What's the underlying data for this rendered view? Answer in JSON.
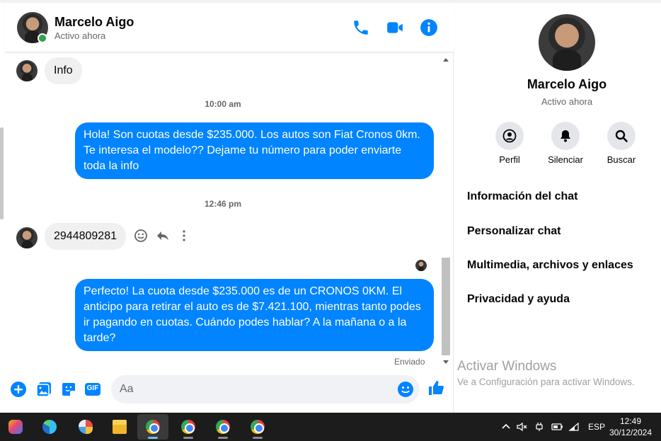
{
  "header": {
    "name": "Marcelo Aigo",
    "status": "Activo ahora"
  },
  "messages": {
    "incoming_1": "Info",
    "time_1": "10:00 am",
    "outgoing_1": "Hola! Son cuotas desde $235.000. Los autos son Fiat Cronos 0km. Te interesa el modelo?? Dejame tu número para poder enviarte toda la info",
    "time_2": "12:46 pm",
    "incoming_2": "2944809281",
    "outgoing_2": "Perfecto! La cuota desde $235.000 es de un CRONOS 0KM. El anticipo para retirar el auto es de $7.421.100, mientras tanto podes ir pagando en cuotas. Cuándo podes hablar? A la mañana o a la tarde?",
    "sent_status": "Enviado"
  },
  "composer": {
    "placeholder": "Aa",
    "gif_label": "GIF"
  },
  "info_panel": {
    "name": "Marcelo Aigo",
    "status": "Activo ahora",
    "actions": [
      {
        "label": "Perfil",
        "icon": "profile-icon"
      },
      {
        "label": "Silenciar",
        "icon": "bell-icon"
      },
      {
        "label": "Buscar",
        "icon": "search-icon"
      }
    ],
    "sections": [
      "Información del chat",
      "Personalizar chat",
      "Multimedia, archivos y enlaces",
      "Privacidad y ayuda"
    ]
  },
  "watermark": {
    "title": "Activar Windows",
    "subtitle": "Ve a Configuración para activar Windows."
  },
  "taskbar": {
    "language": "ESP",
    "time": "12:49",
    "date": "30/12/2024"
  },
  "colors": {
    "accent": "#0084ff",
    "online": "#31a24c"
  }
}
